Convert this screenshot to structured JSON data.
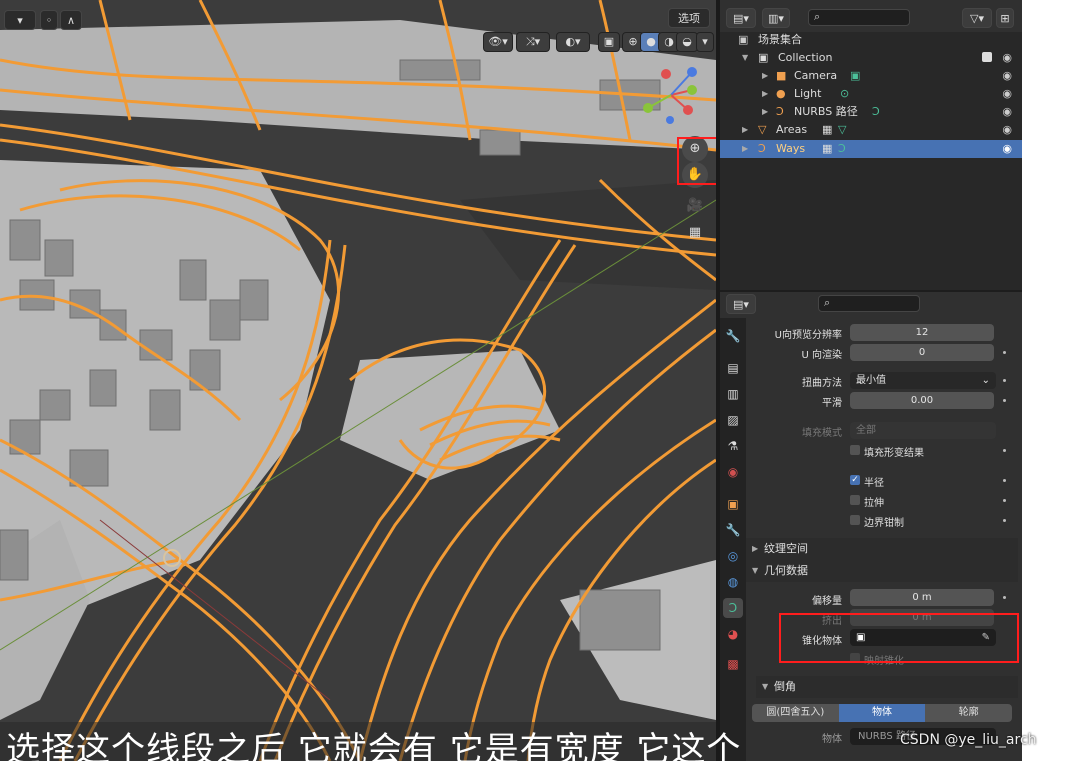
{
  "viewport": {
    "header_select": "选项",
    "view_buttons": [
      "visibility-icon",
      "gizmo-icon",
      "overlay-icon",
      "xray-icon",
      "solid-icon",
      "material-icon",
      "rendered-icon"
    ]
  },
  "outliner": {
    "search_placeholder": "",
    "scene_collection": "场景集合",
    "items": [
      {
        "label": "Collection",
        "icon": "collection-icon"
      },
      {
        "label": "Camera",
        "icon": "camera-icon"
      },
      {
        "label": "Light",
        "icon": "light-icon"
      },
      {
        "label": "NURBS 路径",
        "icon": "curve-icon"
      },
      {
        "label": "Areas",
        "icon": "areas-icon"
      },
      {
        "label": "Ways",
        "icon": "curve-icon"
      }
    ]
  },
  "properties": {
    "u_preview_label": "U向预览分辨率",
    "u_preview_value": "12",
    "u_render_label": "U 向渲染",
    "u_render_value": "0",
    "twist_label": "扭曲方法",
    "twist_value": "最小值",
    "smooth_label": "平滑",
    "smooth_value": "0.00",
    "fill_label": "填充模式",
    "fill_value": "全部",
    "fill_deform_label": "填充形变结果",
    "radius_label": "半径",
    "stretch_label": "拉伸",
    "bounds_label": "边界钳制",
    "texture_space_label": "纹理空间",
    "geometry_label": "几何数据",
    "offset_label": "偏移量",
    "offset_value": "0 m",
    "extrude_label": "挤出",
    "extrude_value": "0 m",
    "taper_label": "锥化物体",
    "map_taper_label": "映射锥化",
    "bevel_label": "倒角",
    "bevel_tabs": [
      "圆(四舍五入)",
      "物体",
      "轮廓"
    ],
    "bottom_obj_label": "物体",
    "bottom_obj_value": "NURBS 路径"
  },
  "watermark": "CSDN @ye_liu_arch",
  "subtitle": "选择这个线段之后 它就会有 它是有宽度 它这个",
  "colors": {
    "road": "#f29b35",
    "selection": "#4772b3",
    "highlight_red": "#ff1d1d",
    "viewport_bg": "#3a3a3a"
  }
}
